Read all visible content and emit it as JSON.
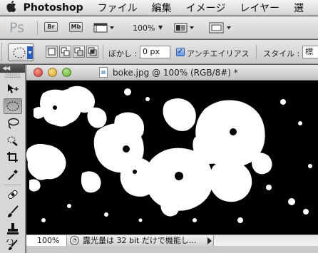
{
  "menubar": {
    "apple_icon": "apple-logo",
    "app_name": "Photoshop",
    "items": [
      "ファイル",
      "編集",
      "イメージ",
      "レイヤー",
      "選"
    ]
  },
  "appbar": {
    "logo_text": "Ps",
    "bridge_label": "Br",
    "minibridge_label": "Mb",
    "zoom_level": "100%"
  },
  "options": {
    "feather_label": "ぼかし :",
    "feather_value": "0 px",
    "antialias_checked": true,
    "antialias_label": "アンチエイリアス",
    "style_label": "スタイル :",
    "style_value": "標"
  },
  "tools_panel": {
    "collapse_label": "◀◀"
  },
  "document": {
    "title": "boke.jpg @ 100% (RGB/8#) *",
    "zoom": "100%",
    "status_text": "露光量は 32 bit だけで機能し..."
  },
  "colors": {
    "close": "#e0463c",
    "minimize": "#e8b52f",
    "zoom": "#6dbb35",
    "canvas_bg": "#000000",
    "shapes": "#ffffff"
  }
}
